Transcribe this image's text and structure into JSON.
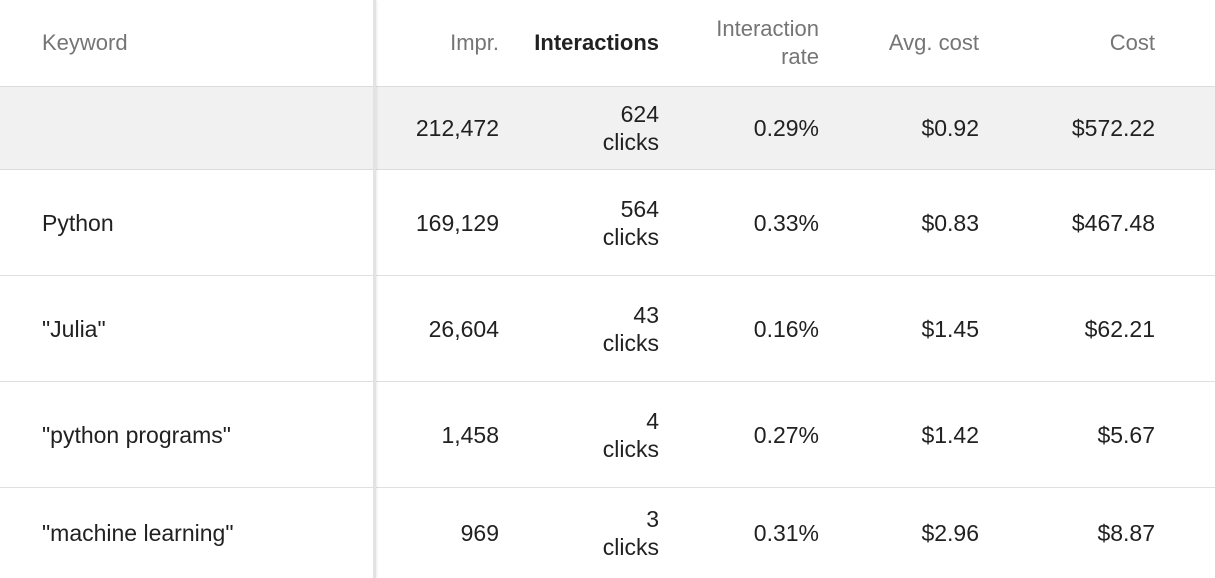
{
  "table": {
    "headers": {
      "keyword": "Keyword",
      "impr": "Impr.",
      "interactions": "Interactions",
      "interaction_rate_line1": "Interaction",
      "interaction_rate_line2": "rate",
      "avg_cost": "Avg. cost",
      "cost": "Cost"
    },
    "total": {
      "keyword": "",
      "impr": "212,472",
      "interactions_count": "624",
      "interactions_unit": "clicks",
      "interaction_rate": "0.29%",
      "avg_cost": "$0.92",
      "cost": "$572.22"
    },
    "rows": [
      {
        "keyword": "Python",
        "impr": "169,129",
        "interactions_count": "564",
        "interactions_unit": "clicks",
        "interaction_rate": "0.33%",
        "avg_cost": "$0.83",
        "cost": "$467.48"
      },
      {
        "keyword": "\"Julia\"",
        "impr": "26,604",
        "interactions_count": "43",
        "interactions_unit": "clicks",
        "interaction_rate": "0.16%",
        "avg_cost": "$1.45",
        "cost": "$62.21"
      },
      {
        "keyword": "\"python programs\"",
        "impr": "1,458",
        "interactions_count": "4",
        "interactions_unit": "clicks",
        "interaction_rate": "0.27%",
        "avg_cost": "$1.42",
        "cost": "$5.67"
      },
      {
        "keyword": "\"machine learning\"",
        "impr": "969",
        "interactions_count": "3",
        "interactions_unit": "clicks",
        "interaction_rate": "0.31%",
        "avg_cost": "$2.96",
        "cost": "$8.87"
      }
    ]
  }
}
